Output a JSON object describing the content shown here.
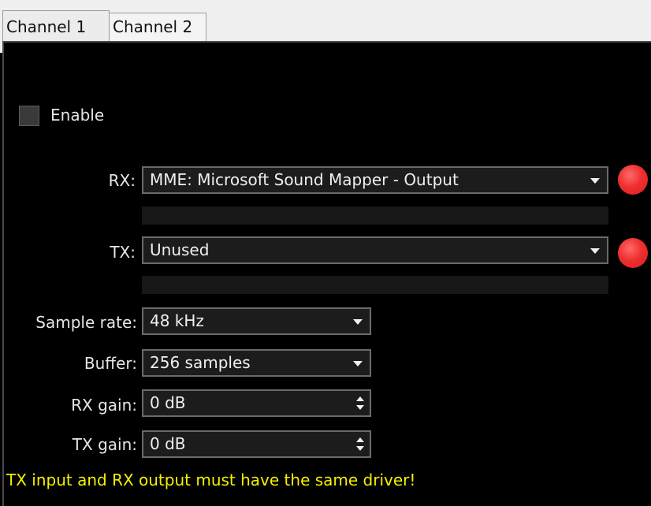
{
  "tabs": [
    {
      "label": "Channel 1",
      "active": true
    },
    {
      "label": "Channel 2",
      "active": false
    }
  ],
  "enable": {
    "label": "Enable",
    "checked": false
  },
  "rx": {
    "label": "RX:",
    "value": "MME: Microsoft Sound Mapper - Output",
    "status_color": "#ef3030"
  },
  "tx": {
    "label": "TX:",
    "value": "Unused",
    "status_color": "#ef3030"
  },
  "sample_rate": {
    "label": "Sample rate:",
    "value": "48 kHz"
  },
  "buffer": {
    "label": "Buffer:",
    "value": "256 samples"
  },
  "rx_gain": {
    "label": "RX gain:",
    "value": "0 dB"
  },
  "tx_gain": {
    "label": "TX gain:",
    "value": "0 dB"
  },
  "warning": {
    "text": "TX input and RX output must have the same driver!",
    "color": "#f5f000"
  }
}
